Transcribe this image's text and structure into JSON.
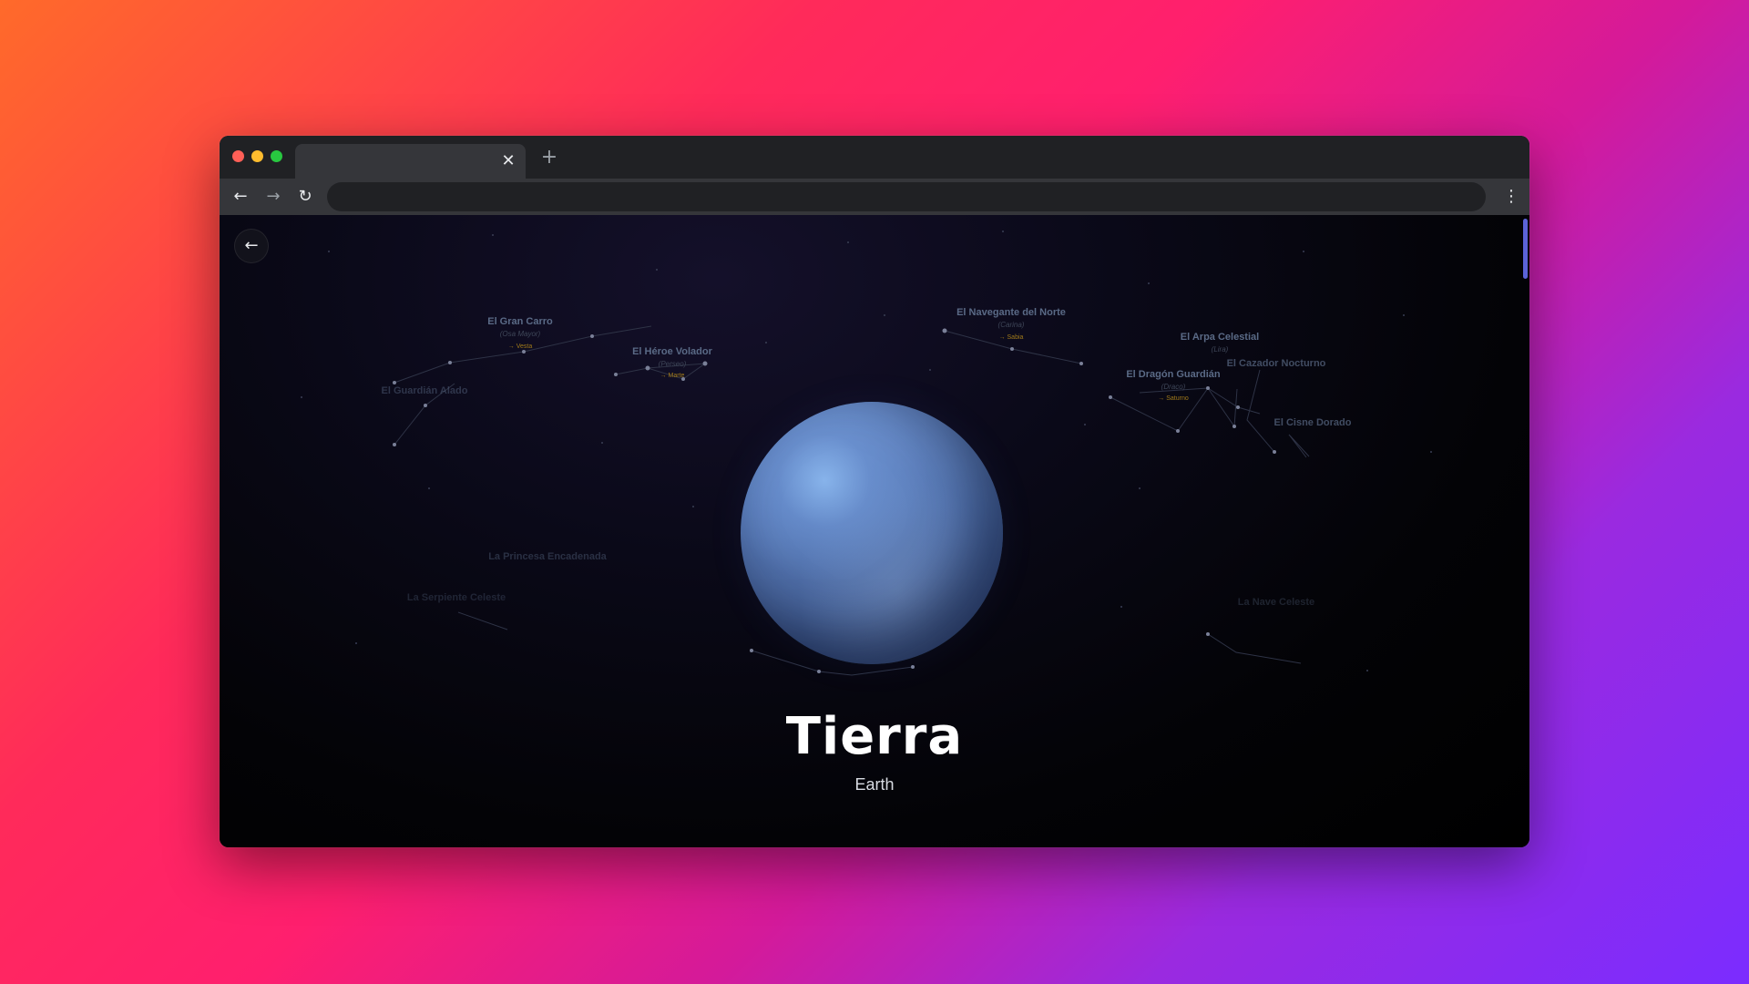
{
  "browser": {
    "tab_close_glyph": "✕",
    "new_tab_glyph": "+",
    "back_glyph": "←",
    "forward_glyph": "→",
    "reload_glyph": "↻",
    "menu_glyph": "⋮",
    "address_value": ""
  },
  "page": {
    "back_glyph": "←",
    "planet_name": "Tierra",
    "planet_subtitle": "Earth",
    "planet_color": "#5f82bf"
  },
  "constellations": [
    {
      "name": "El Gran Carro",
      "sub": "(Osa Mayor)",
      "star": "→ Vesta"
    },
    {
      "name": "El Héroe Volador",
      "sub": "(Perseo)",
      "star": "→ Marte"
    },
    {
      "name": "El Navegante del Norte",
      "sub": "(Carina)",
      "star": "→ Sabia"
    },
    {
      "name": "El Arpa Celestial",
      "sub": "(Lira)",
      "star": ""
    },
    {
      "name": "El Dragón Guardián",
      "sub": "(Draco)",
      "star": "→ Saturno"
    },
    {
      "name": "El Cazador Nocturno",
      "sub": "",
      "star": ""
    },
    {
      "name": "El Cisne Dorado",
      "sub": "",
      "star": ""
    },
    {
      "name": "El Guardián Alado",
      "sub": "",
      "star": ""
    },
    {
      "name": "La Princesa Encadenada",
      "sub": "",
      "star": ""
    },
    {
      "name": "La Serpiente Celeste",
      "sub": "",
      "star": ""
    },
    {
      "name": "La Nave Celeste",
      "sub": "",
      "star": ""
    }
  ]
}
